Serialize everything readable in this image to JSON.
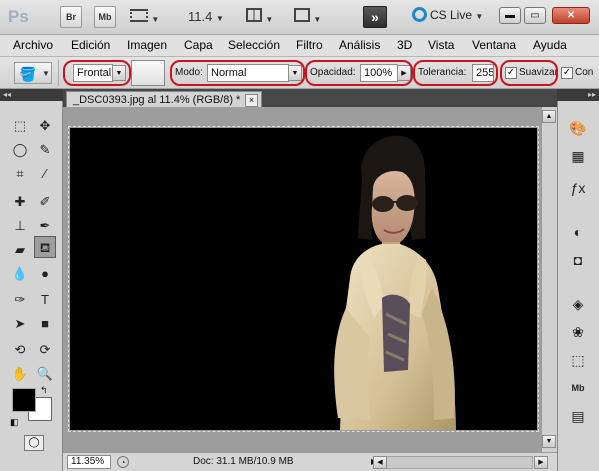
{
  "appbar": {
    "logo": "Ps",
    "bridge_label": "Br",
    "minibridge_label": "Mb",
    "zoom_value": "11.4",
    "cslive_label": "CS Live",
    "workspace_switch_label": "»"
  },
  "menu": [
    "Archivo",
    "Edición",
    "Imagen",
    "Capa",
    "Selección",
    "Filtro",
    "Análisis",
    "3D",
    "Vista",
    "Ventana",
    "Ayuda"
  ],
  "options": {
    "fill_source": "Frontal",
    "mode_label": "Modo:",
    "mode_value": "Normal",
    "opacity_label": "Opacidad:",
    "opacity_value": "100%",
    "tolerance_label": "Tolerancia:",
    "tolerance_value": "255",
    "smooth_label": "Suavizar",
    "contiguous_label": "Con"
  },
  "document": {
    "tab_title": "_DSC0393.jpg al 11.4% (RGB/8) *",
    "close_glyph": "×"
  },
  "status": {
    "zoom": "11.35%",
    "doc_info": "Doc: 31.1 MB/10.9 MB"
  },
  "colors": {
    "foreground": "#000000",
    "background": "#ffffff",
    "highlight_ring": "#c8141e",
    "canvas": "#000000"
  }
}
